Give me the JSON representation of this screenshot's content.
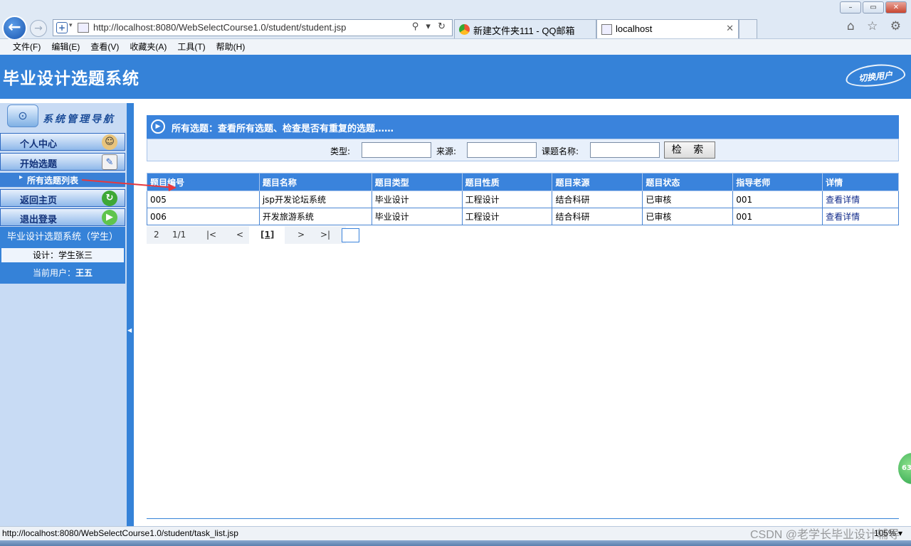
{
  "browser": {
    "window_controls": [
      "–",
      "▭",
      "✕"
    ],
    "url": "http://localhost:8080/WebSelectCourse1.0/student/student.jsp",
    "address_tools": "⚲ ▾ ↻",
    "tabs": [
      {
        "label": "新建文件夹111 - QQ邮箱"
      },
      {
        "label": "localhost",
        "close": "✕"
      }
    ],
    "fav_icons": "⌂ ☆ ⚙",
    "menu": [
      "文件(F)",
      "编辑(E)",
      "查看(V)",
      "收藏夹(A)",
      "工具(T)",
      "帮助(H)"
    ],
    "status_url": "http://localhost:8080/WebSelectCourse1.0/student/task_list.jsp",
    "zoom": "105% ▾"
  },
  "app": {
    "title": "毕业设计选题系统",
    "switch_user": "切换用户"
  },
  "sidebar": {
    "nav_title": "系统管理导航",
    "items": [
      {
        "label": "个人中心",
        "icon": "user-icon"
      },
      {
        "label": "开始选题",
        "icon": "edit-icon"
      },
      {
        "label": "返回主页",
        "icon": "refresh-arrow-icon"
      },
      {
        "label": "退出登录",
        "icon": "play-icon"
      }
    ],
    "sub_item": "所有选题列表",
    "system_name": "毕业设计选题系统（学生）",
    "design": "设计：学生张三",
    "current_user_label": "当前用户：",
    "current_user": "王五"
  },
  "main": {
    "panel_title": "所有选题：查看所有选题、检查是否有重复的选题……",
    "search": {
      "type_label": "类型:",
      "source_label": "来源:",
      "name_label": "课题名称:",
      "type_value": "",
      "source_value": "",
      "name_value": "",
      "button": "检 索"
    },
    "columns": [
      "题目编号",
      "题目名称",
      "题目类型",
      "题目性质",
      "题目来源",
      "题目状态",
      "指导老师",
      "详情"
    ],
    "rows": [
      [
        "005",
        "jsp开发论坛系统",
        "毕业设计",
        "工程设计",
        "结合科研",
        "已审核",
        "001",
        "查看详情"
      ],
      [
        "006",
        "开发旅游系统",
        "毕业设计",
        "工程设计",
        "结合科研",
        "已审核",
        "001",
        "查看详情"
      ]
    ],
    "pager": {
      "total": "2",
      "pages": "1/1",
      "first": "|<",
      "prev": "<",
      "current": "[1]",
      "next": ">",
      "last": ">|",
      "goto_value": ""
    }
  },
  "watermark": "CSDN @老学长毕业设计辅导",
  "float_badge": "63",
  "colors": {
    "header_blue": "#3582d8",
    "sidebar_bg": "#c8dbf4",
    "table_head": "#3a83dc",
    "annotation_arrow": "#e8383d"
  }
}
